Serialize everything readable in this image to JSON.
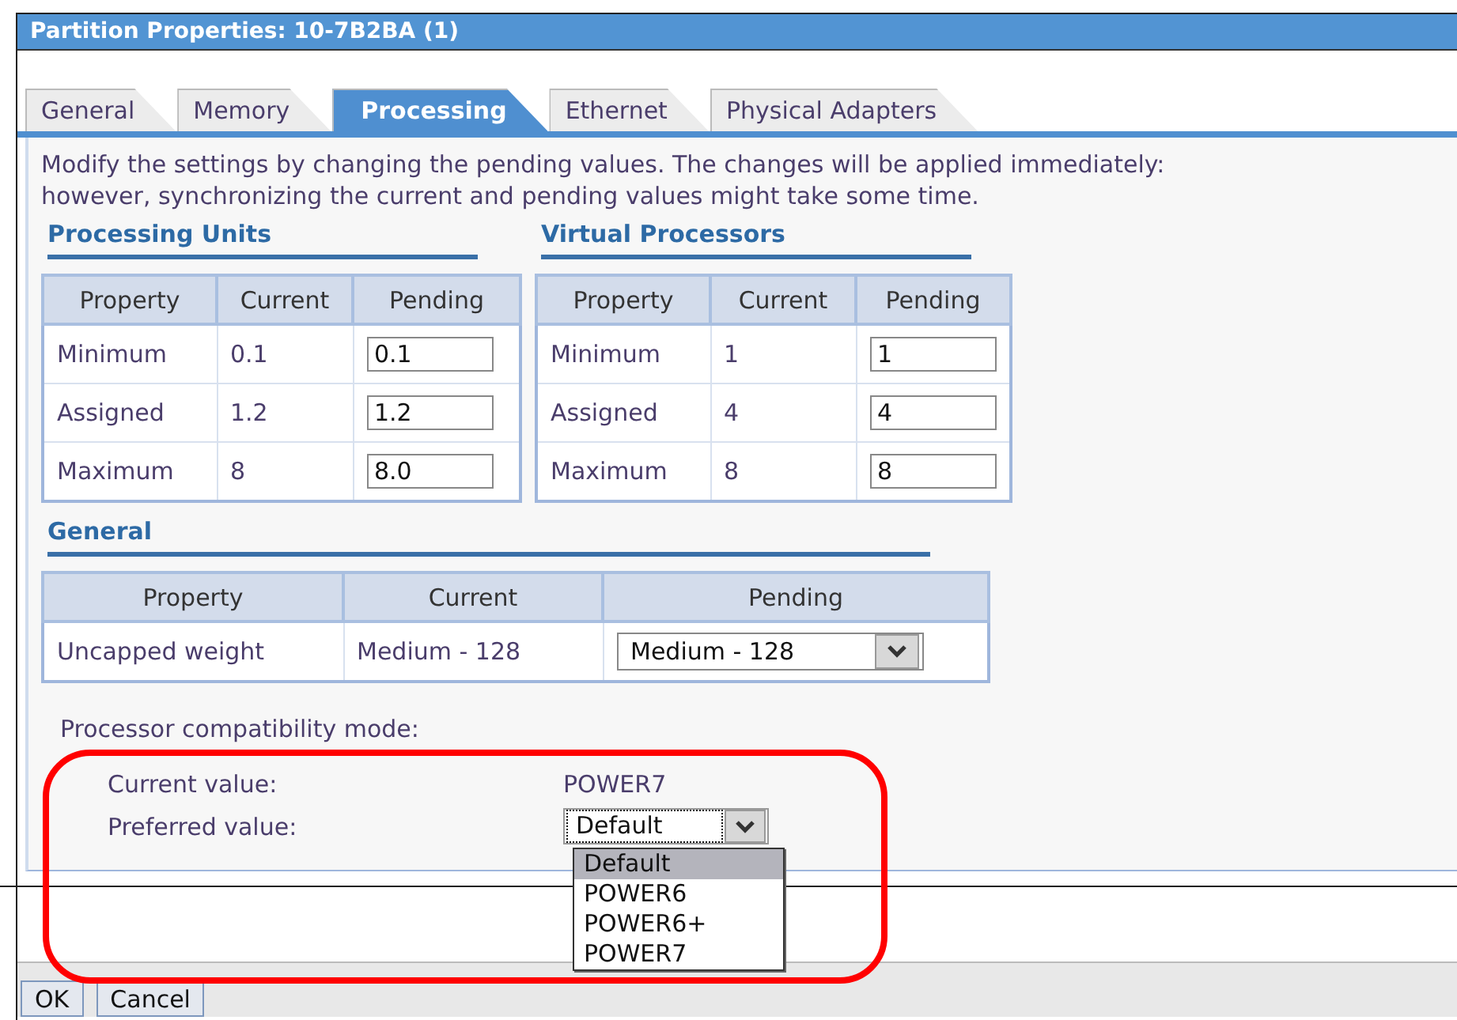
{
  "window": {
    "title": "Partition Properties: 10-7B2BA (1)"
  },
  "tabs": [
    {
      "label": "General",
      "selected": false
    },
    {
      "label": "Memory",
      "selected": false
    },
    {
      "label": "Processing",
      "selected": true
    },
    {
      "label": "Ethernet",
      "selected": false
    },
    {
      "label": "Physical Adapters",
      "selected": false
    }
  ],
  "description": "Modify the settings by changing the pending values. The changes will be applied immediately: however, synchronizing the current and pending values might take some time.",
  "processing_units": {
    "heading": "Processing Units",
    "columns": [
      "Property",
      "Current",
      "Pending"
    ],
    "rows": [
      {
        "property": "Minimum",
        "current": "0.1",
        "pending": "0.1",
        "kind": "input"
      },
      {
        "property": "Assigned",
        "current": "1.2",
        "pending": "1.2",
        "kind": "input"
      },
      {
        "property": "Maximum",
        "current": "8",
        "pending": "8.0",
        "kind": "input"
      }
    ]
  },
  "virtual_processors": {
    "heading": "Virtual Processors",
    "columns": [
      "Property",
      "Current",
      "Pending"
    ],
    "rows": [
      {
        "property": "Minimum",
        "current": "1",
        "pending": "1",
        "kind": "input"
      },
      {
        "property": "Assigned",
        "current": "4",
        "pending": "4",
        "kind": "input"
      },
      {
        "property": "Maximum",
        "current": "8",
        "pending": "8",
        "kind": "input"
      }
    ]
  },
  "general": {
    "heading": "General",
    "columns": [
      "Property",
      "Current",
      "Pending"
    ],
    "rows": [
      {
        "property": "Uncapped weight",
        "current": "Medium - 128",
        "pending": "Medium - 128",
        "kind": "select"
      }
    ]
  },
  "compatibility": {
    "label": "Processor compatibility mode:",
    "current_label": "Current value:",
    "current_value": "POWER7",
    "preferred_label": "Preferred value:",
    "preferred_value": "Default",
    "expanded": true,
    "options": [
      {
        "label": "Default",
        "selected": true
      },
      {
        "label": "POWER6",
        "selected": false
      },
      {
        "label": "POWER6+",
        "selected": false
      },
      {
        "label": "POWER7",
        "selected": false
      }
    ]
  },
  "buttons": [
    "OK",
    "Cancel"
  ]
}
